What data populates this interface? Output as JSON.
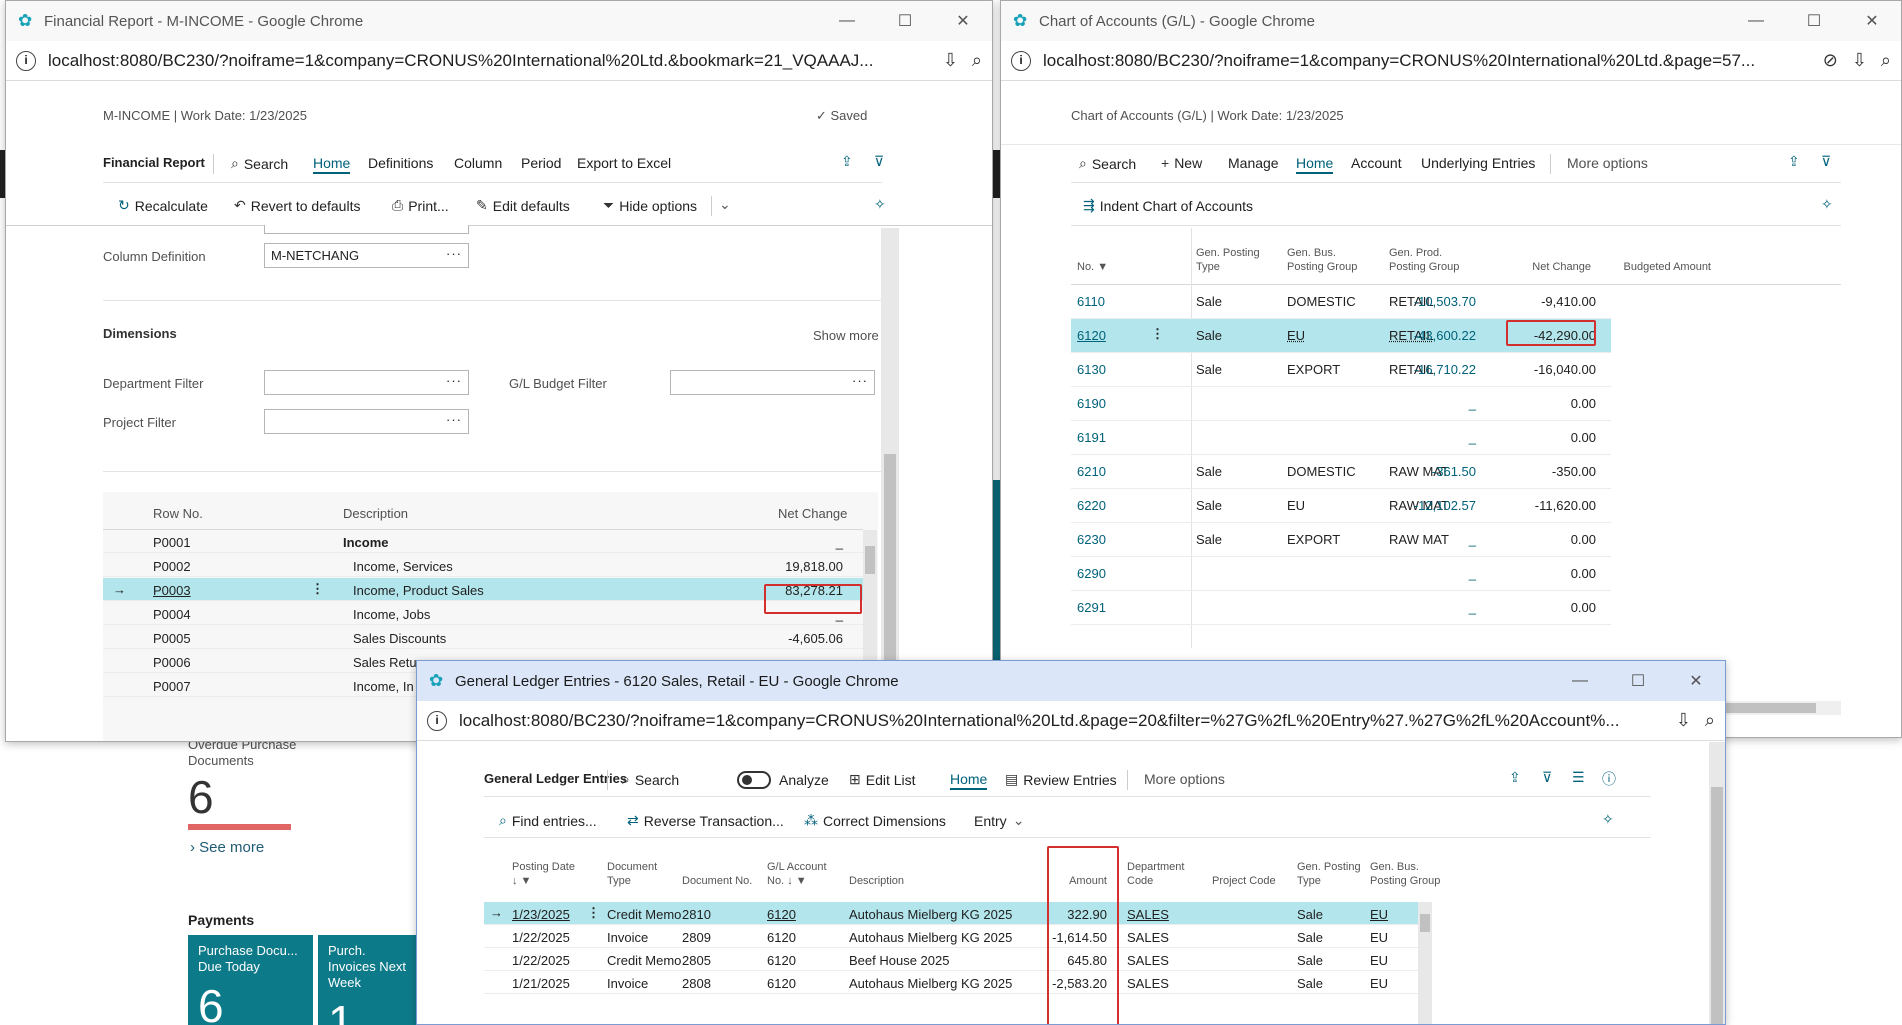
{
  "background": {
    "overdue_label": "Overdue Purchase Documents",
    "overdue_value": "6",
    "see_more": "See more",
    "payments_title": "Payments",
    "cue1_label": "Purchase Docu... Due Today",
    "cue1_value": "6",
    "cue2_label": "Purch. Invoices Next Week",
    "cue2_value": "1"
  },
  "win1": {
    "title": "Financial Report - M-INCOME - Google Chrome",
    "url": "localhost:8080/BC230/?noiframe=1&company=CRONUS%20International%20Ltd.&bookmark=21_VQAAAJ...",
    "header": "M-INCOME | Work Date: 1/23/2025",
    "saved": "Saved",
    "actions": [
      "Financial Report",
      "Search",
      "Home",
      "Definitions",
      "Column",
      "Period",
      "Export to Excel"
    ],
    "subactions": [
      "Recalculate",
      "Revert to defaults",
      "Print...",
      "Edit defaults",
      "Hide options"
    ],
    "column_def_label": "Column Definition",
    "column_def_value": "M-NETCHANG",
    "dimensions": "Dimensions",
    "show_more": "Show more",
    "dept_filter": "Department Filter",
    "gl_budget_filter": "G/L Budget Filter",
    "project_filter": "Project Filter",
    "cols": {
      "row_no": "Row No.",
      "description": "Description",
      "net_change": "Net Change"
    },
    "rows": [
      {
        "no": "P0001",
        "desc": "Income",
        "val": "_"
      },
      {
        "no": "P0002",
        "desc": "Income, Services",
        "val": "19,818.00"
      },
      {
        "no": "P0003",
        "desc": "Income, Product Sales",
        "val": "83,278.21"
      },
      {
        "no": "P0004",
        "desc": "Income, Jobs",
        "val": "_"
      },
      {
        "no": "P0005",
        "desc": "Sales Discounts",
        "val": "-4,605.06"
      },
      {
        "no": "P0006",
        "desc": "Sales Retu",
        "val": ""
      },
      {
        "no": "P0007",
        "desc": "Income, In",
        "val": ""
      }
    ]
  },
  "win2": {
    "title": "Chart of Accounts (G/L) - Google Chrome",
    "url": "localhost:8080/BC230/?noiframe=1&company=CRONUS%20International%20Ltd.&page=57...",
    "header": "Chart of Accounts (G/L) | Work Date: 1/23/2025",
    "actions": [
      "Search",
      "New",
      "Manage",
      "Home",
      "Account",
      "Underlying Entries",
      "More options"
    ],
    "indent": "Indent Chart of Accounts",
    "cols": {
      "no": "No.",
      "gpt": "Gen. Posting Type",
      "gbpg": "Gen. Bus. Posting Group",
      "gppg": "Gen. Prod. Posting Group",
      "net": "Net Change",
      "budget": "Budgeted Amount"
    },
    "rows": [
      {
        "no": "6110",
        "gpt": "Sale",
        "gbpg": "DOMESTIC",
        "gppg": "RETAIL",
        "net": "-10,503.70",
        "budget": "-9,410.00"
      },
      {
        "no": "6120",
        "gpt": "Sale",
        "gbpg": "EU",
        "gppg": "RETAIL",
        "net": "-43,600.22",
        "budget": "-42,290.00"
      },
      {
        "no": "6130",
        "gpt": "Sale",
        "gbpg": "EXPORT",
        "gppg": "RETAIL",
        "net": "-16,710.22",
        "budget": "-16,040.00"
      },
      {
        "no": "6190",
        "gpt": "",
        "gbpg": "",
        "gppg": "",
        "net": "_",
        "budget": "0.00"
      },
      {
        "no": "6191",
        "gpt": "",
        "gbpg": "",
        "gppg": "",
        "net": "_",
        "budget": "0.00"
      },
      {
        "no": "6210",
        "gpt": "Sale",
        "gbpg": "DOMESTIC",
        "gppg": "RAW MAT",
        "net": "-361.50",
        "budget": "-350.00"
      },
      {
        "no": "6220",
        "gpt": "Sale",
        "gbpg": "EU",
        "gppg": "RAW MAT",
        "net": "-12,102.57",
        "budget": "-11,620.00"
      },
      {
        "no": "6230",
        "gpt": "Sale",
        "gbpg": "EXPORT",
        "gppg": "RAW MAT",
        "net": "_",
        "budget": "0.00"
      },
      {
        "no": "6290",
        "gpt": "",
        "gbpg": "",
        "gppg": "",
        "net": "_",
        "budget": "0.00"
      },
      {
        "no": "6291",
        "gpt": "",
        "gbpg": "",
        "gppg": "",
        "net": "_",
        "budget": "0.00"
      }
    ]
  },
  "win3": {
    "title": "General Ledger Entries - 6120 Sales, Retail - EU - Google Chrome",
    "url": "localhost:8080/BC230/?noiframe=1&company=CRONUS%20International%20Ltd.&page=20&filter=%27G%2fL%20Entry%27.%27G%2fL%20Account%...",
    "actions": [
      "General Ledger Entries",
      "Search",
      "Analyze",
      "Edit List",
      "Home",
      "Review Entries",
      "More options"
    ],
    "subactions": [
      "Find entries...",
      "Reverse Transaction...",
      "Correct Dimensions",
      "Entry"
    ],
    "cols": {
      "date": "Posting Date",
      "doctype": "Document Type",
      "docno": "Document No.",
      "glno": "G/L Account No.",
      "desc": "Description",
      "amount": "Amount",
      "dept": "Department Code",
      "proj": "Project Code",
      "gpt": "Gen. Posting Type",
      "gbpg": "Gen. Bus. Posting Group"
    },
    "rows": [
      {
        "date": "1/23/2025",
        "doctype": "Credit Memo",
        "docno": "2810",
        "glno": "6120",
        "desc": "Autohaus Mielberg KG 2025",
        "amount": "322.90",
        "dept": "SALES",
        "gpt": "Sale",
        "gbpg": "EU"
      },
      {
        "date": "1/22/2025",
        "doctype": "Invoice",
        "docno": "2809",
        "glno": "6120",
        "desc": "Autohaus Mielberg KG 2025",
        "amount": "-1,614.50",
        "dept": "SALES",
        "gpt": "Sale",
        "gbpg": "EU"
      },
      {
        "date": "1/22/2025",
        "doctype": "Credit Memo",
        "docno": "2805",
        "glno": "6120",
        "desc": "Beef House 2025",
        "amount": "645.80",
        "dept": "SALES",
        "gpt": "Sale",
        "gbpg": "EU"
      },
      {
        "date": "1/21/2025",
        "doctype": "Invoice",
        "docno": "2808",
        "glno": "6120",
        "desc": "Autohaus Mielberg KG 2025",
        "amount": "-2,583.20",
        "dept": "SALES",
        "gpt": "Sale",
        "gbpg": "EU"
      }
    ]
  }
}
